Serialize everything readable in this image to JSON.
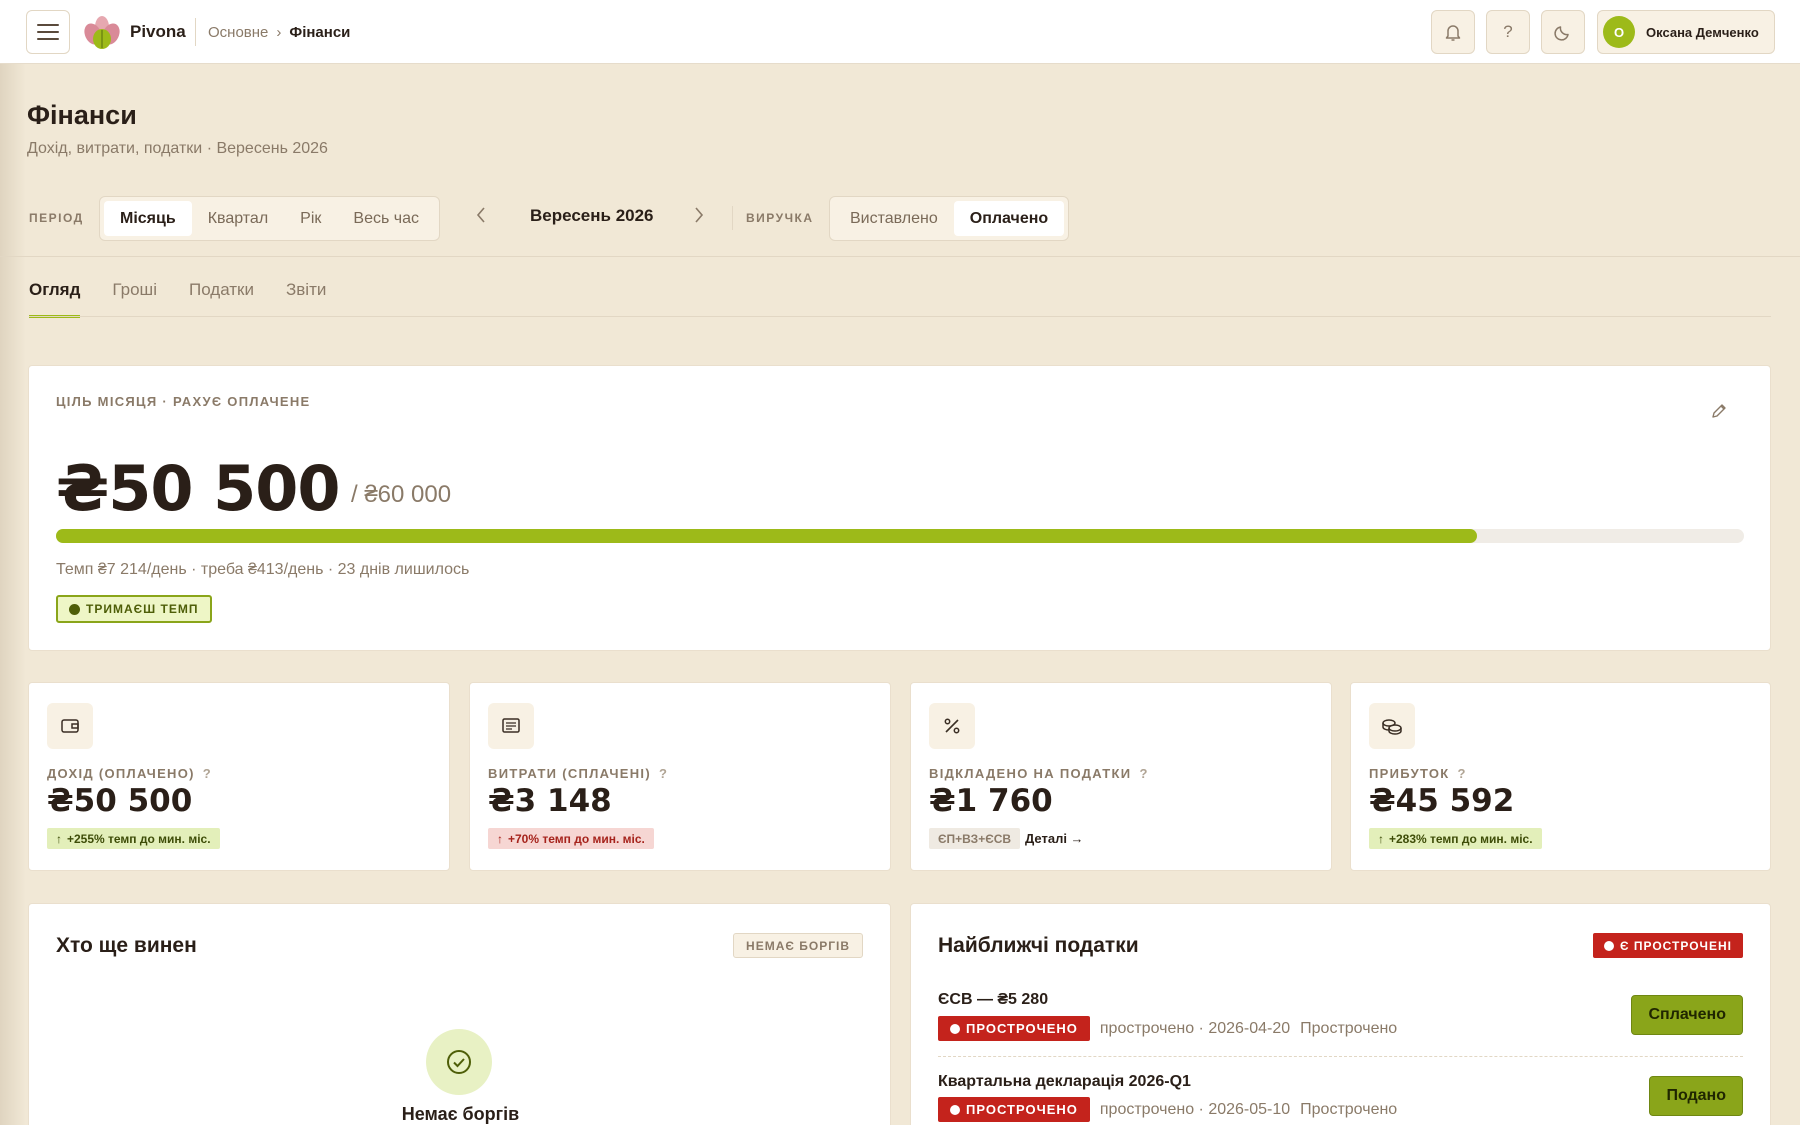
{
  "header": {
    "brand": "Pivona",
    "breadcrumb": [
      "Основне",
      "Фінанси"
    ],
    "breadcrumb_sep": "›",
    "help": "?",
    "user": {
      "initial": "О",
      "name": "Оксана Демченко"
    }
  },
  "page": {
    "title": "Фінанси",
    "subtitle": "Дохід, витрати, податки · Вересень 2026"
  },
  "filters": {
    "period_label": "ПЕРІОД",
    "period_options": [
      "Місяць",
      "Квартал",
      "Рік",
      "Весь час"
    ],
    "period_selected": "Місяць",
    "current_period": "Вересень 2026",
    "prev": "‹",
    "next": "›",
    "revenue_label": "ВИРУЧКА",
    "revenue_options": [
      "Виставлено",
      "Оплачено"
    ],
    "revenue_selected": "Оплачено"
  },
  "tabs": [
    "Огляд",
    "Гроші",
    "Податки",
    "Звіти"
  ],
  "tab_active": "Огляд",
  "goal": {
    "label": "ЦІЛЬ МІСЯЦЯ · РАХУЄ ОПЛАЧЕНЕ",
    "value": "₴50 500",
    "target": "/ ₴60 000",
    "progress": 0.8417,
    "pace": "Темп ₴7 214/день · треба ₴413/день · 23 днів лишилось",
    "status": "ТРИМАЄШ ТЕМП"
  },
  "kpis": [
    {
      "icon": "wallet-icon",
      "label": "ДОХІД (ОПЛАЧЕНО)",
      "help": "?",
      "value": "₴50 500",
      "delta": "+255% темп до мин. міс.",
      "direction": "up"
    },
    {
      "icon": "receipt-icon",
      "label": "ВИТРАТИ (СПЛАЧЕНІ)",
      "help": "?",
      "value": "₴3 148",
      "delta": "+70% темп до мин. міс.",
      "direction": "down"
    },
    {
      "icon": "percent-icon",
      "label": "ВІДКЛАДЕНО НА ПОДАТКИ",
      "help": "?",
      "value": "₴1 760",
      "tag": "ЄП+ВЗ+ЄСВ",
      "link": "Деталі →"
    },
    {
      "icon": "coins-icon",
      "label": "ПРИБУТОК",
      "help": "?",
      "value": "₴45 592",
      "delta": "+283% темп до мин. міс.",
      "direction": "up"
    }
  ],
  "debts": {
    "title": "Хто ще винен",
    "badge": "НЕМАЄ БОРГІВ",
    "empty_text": "Немає боргів"
  },
  "taxes": {
    "title": "Найближчі податки",
    "badge": "Є ПРОСТРОЧЕНІ",
    "items": [
      {
        "name": "ЄСВ — ₴5 280",
        "status": "ПРОСТРОЧЕНО",
        "meta": "прострочено · 2026-04-20",
        "state": "Прострочено",
        "action": "Сплачено"
      },
      {
        "name": "Квартальна декларація 2026-Q1",
        "status": "ПРОСТРОЧЕНО",
        "meta": "прострочено · 2026-05-10",
        "state": "Прострочено",
        "action": "Подано"
      }
    ]
  },
  "colors": {
    "accent": "#9dba19",
    "danger": "#c4231c",
    "background": "#f1e8d6"
  }
}
